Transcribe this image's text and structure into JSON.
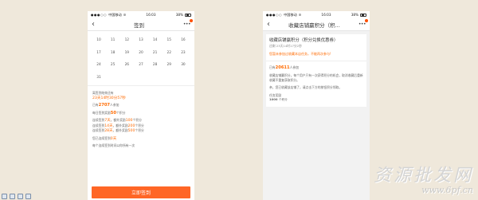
{
  "left_phone": {
    "status": {
      "carrier": "中国移动",
      "wifi": "WiFi",
      "time": "16:03",
      "battery": "38%"
    },
    "nav": {
      "back": "‹",
      "title": "签到",
      "more": "•••"
    },
    "calendar_rows": [
      [
        "10",
        "11",
        "12",
        "13",
        "14",
        "15",
        "16"
      ],
      [
        "17",
        "18",
        "19",
        "20",
        "21",
        "22",
        "23"
      ],
      [
        "24",
        "25",
        "26",
        "27",
        "28",
        "29",
        "30"
      ],
      [
        "31",
        "",
        "",
        "",
        "",
        "",
        ""
      ]
    ],
    "info": {
      "countdown_label": "离签到结束还有",
      "countdown": "23天14时30分57秒",
      "participants_prefix": "已有",
      "participants": "2707",
      "participants_suffix": "人参加",
      "daily_prefix": "每日签到奖励",
      "daily": "50",
      "daily_suffix": "个积分",
      "r1_a": "连续签到",
      "r1_days": "7天",
      "r1_b": "，额外奖励",
      "r1_pts": "100",
      "r1_c": "个积分",
      "r2_a": "连续签到",
      "r2_days": "14天",
      "r2_b": "，额外奖励",
      "r2_pts": "200",
      "r2_c": "个积分",
      "r3_a": "连续签到",
      "r3_days": "28天",
      "r3_b": "，额外奖励",
      "r3_pts": "500",
      "r3_c": "个积分",
      "already_prefix": "您已连续签到",
      "already": "0天",
      "note": "每个连续签到时间以你所有一次"
    },
    "button": "立即签到"
  },
  "right_phone": {
    "status": {
      "carrier": "中国移动",
      "wifi": "WiFi",
      "time": "16:03",
      "battery": "38%"
    },
    "nav": {
      "back": "‹",
      "title": "收藏店铺赢积分（积...",
      "more": "•••"
    },
    "card": {
      "title": "收藏店铺赢积分（积分兑换优惠券）",
      "line": "还剩 23天14时17分2秒",
      "warning": "您暂未参加过收藏本店任务，不能再次参与!"
    },
    "card2": {
      "p_prefix": "已有",
      "participants": "20611",
      "p_suffix": "人参加",
      "desc1": "收藏店铺赢积分，每个用户只有一次获得积分的机会，取消收藏后重新收藏不重复获取积分。",
      "desc2": "亲，您已收藏该店铺了，请点击下方的按钮积分领取。",
      "reward_label": "任务奖励",
      "reward": "1000",
      "reward_unit": "个积分"
    }
  },
  "watermark": {
    "cn": "资源批发网",
    "url": "www.6pf.cn"
  }
}
